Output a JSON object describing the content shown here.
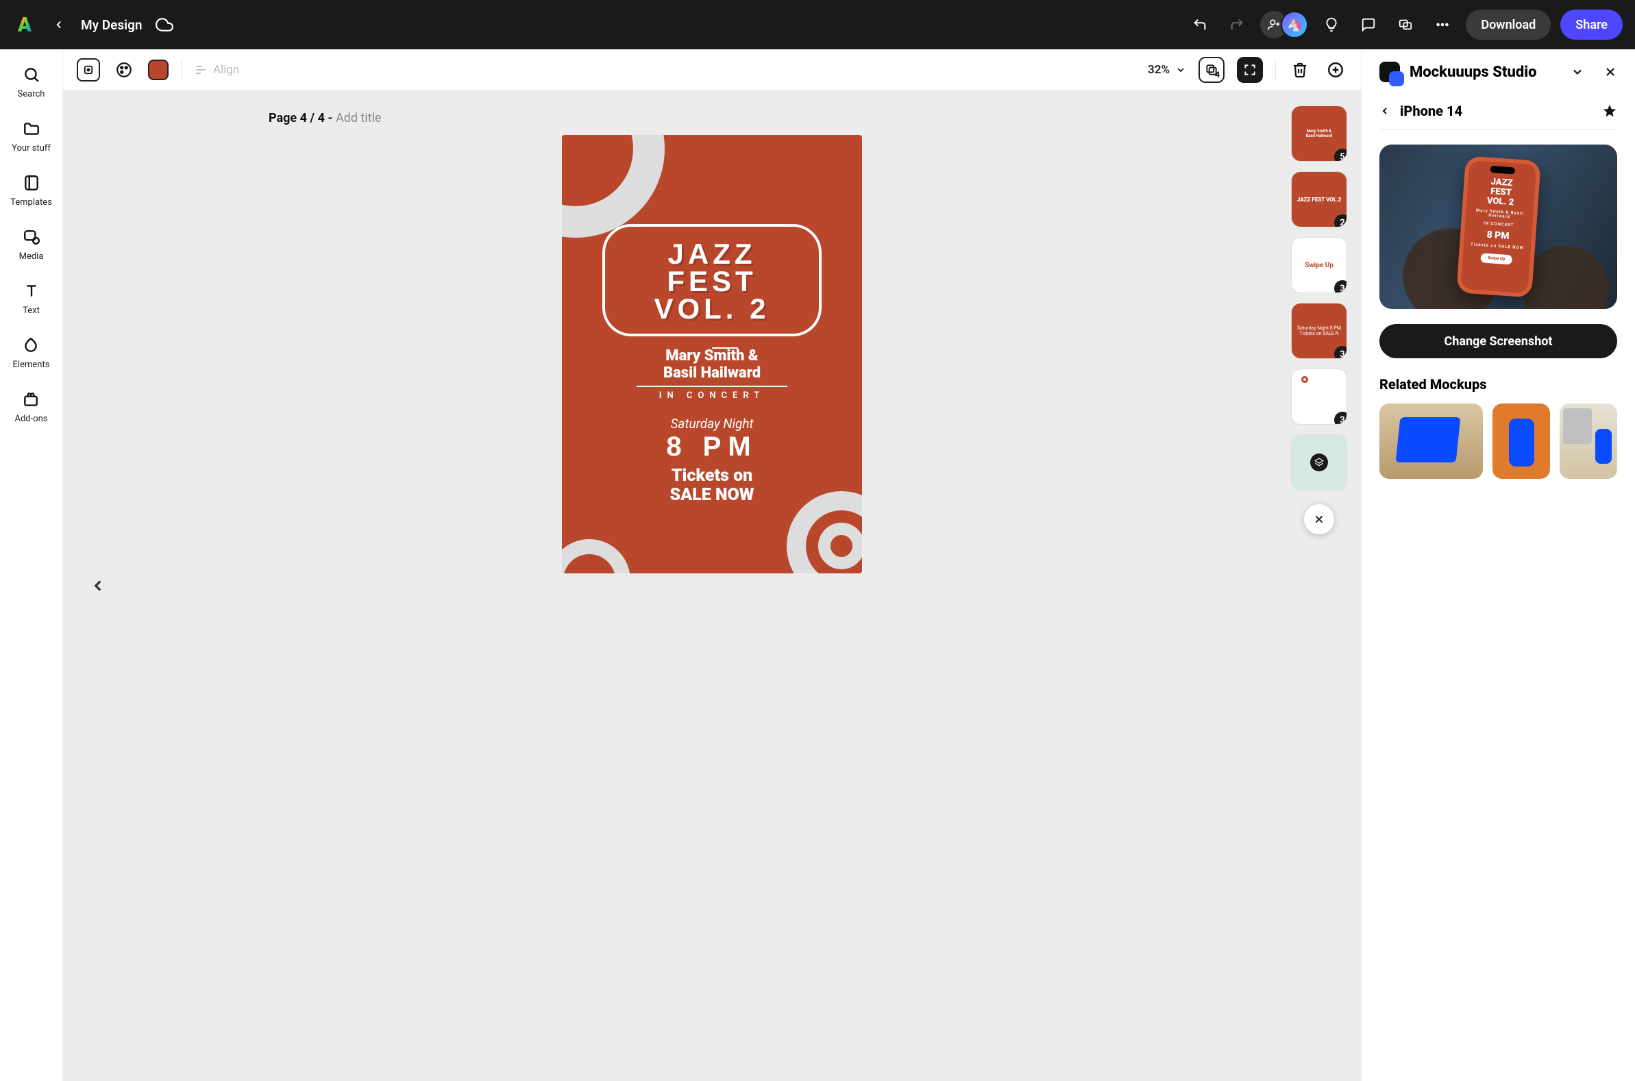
{
  "header": {
    "title": "My Design",
    "download": "Download",
    "share": "Share"
  },
  "rail": {
    "search": "Search",
    "your_stuff": "Your stuff",
    "templates": "Templates",
    "media": "Media",
    "text": "Text",
    "elements": "Elements",
    "addons": "Add-ons"
  },
  "toolbar": {
    "align": "Align",
    "zoom": "32%",
    "layers_badge": "4",
    "swatch_color": "#b9472c"
  },
  "page": {
    "label_prefix": "Page 4 / 4 - ",
    "hint": "Add title"
  },
  "poster": {
    "title_l1": "JAZZ",
    "title_l2": "FEST",
    "title_l3": "VOL. 2",
    "artists_l1": "Mary Smith &",
    "artists_l2": "Basil Hailward",
    "subtitle": "IN CONCERT",
    "sat": "Saturday Night",
    "time": "8 PM",
    "tix_l1": "Tickets on",
    "tix_l2": "SALE NOW"
  },
  "thumbs": {
    "t1": {
      "badge": "5"
    },
    "t2": {
      "badge": "2",
      "text": "JAZZ FEST VOL.2"
    },
    "t3": {
      "badge": "3",
      "text": "Swipe Up"
    },
    "t4": {
      "badge": "3",
      "text": "Saturday Night 8 PM Tickets on SALE N"
    },
    "t5": {
      "badge": "3"
    }
  },
  "panel": {
    "app": "Mockuuups Studio",
    "device": "iPhone 14",
    "change": "Change Screenshot",
    "related": "Related Mockups",
    "phone_preview": {
      "l1": "JAZZ",
      "l2": "FEST",
      "l3": "VOL. 2",
      "artists": "Mary Smith & Basil Hailward",
      "sub": "IN CONCERT",
      "time": "8 PM",
      "tix": "Tickets on SALE NOW",
      "pill": "Swipe Up"
    }
  }
}
